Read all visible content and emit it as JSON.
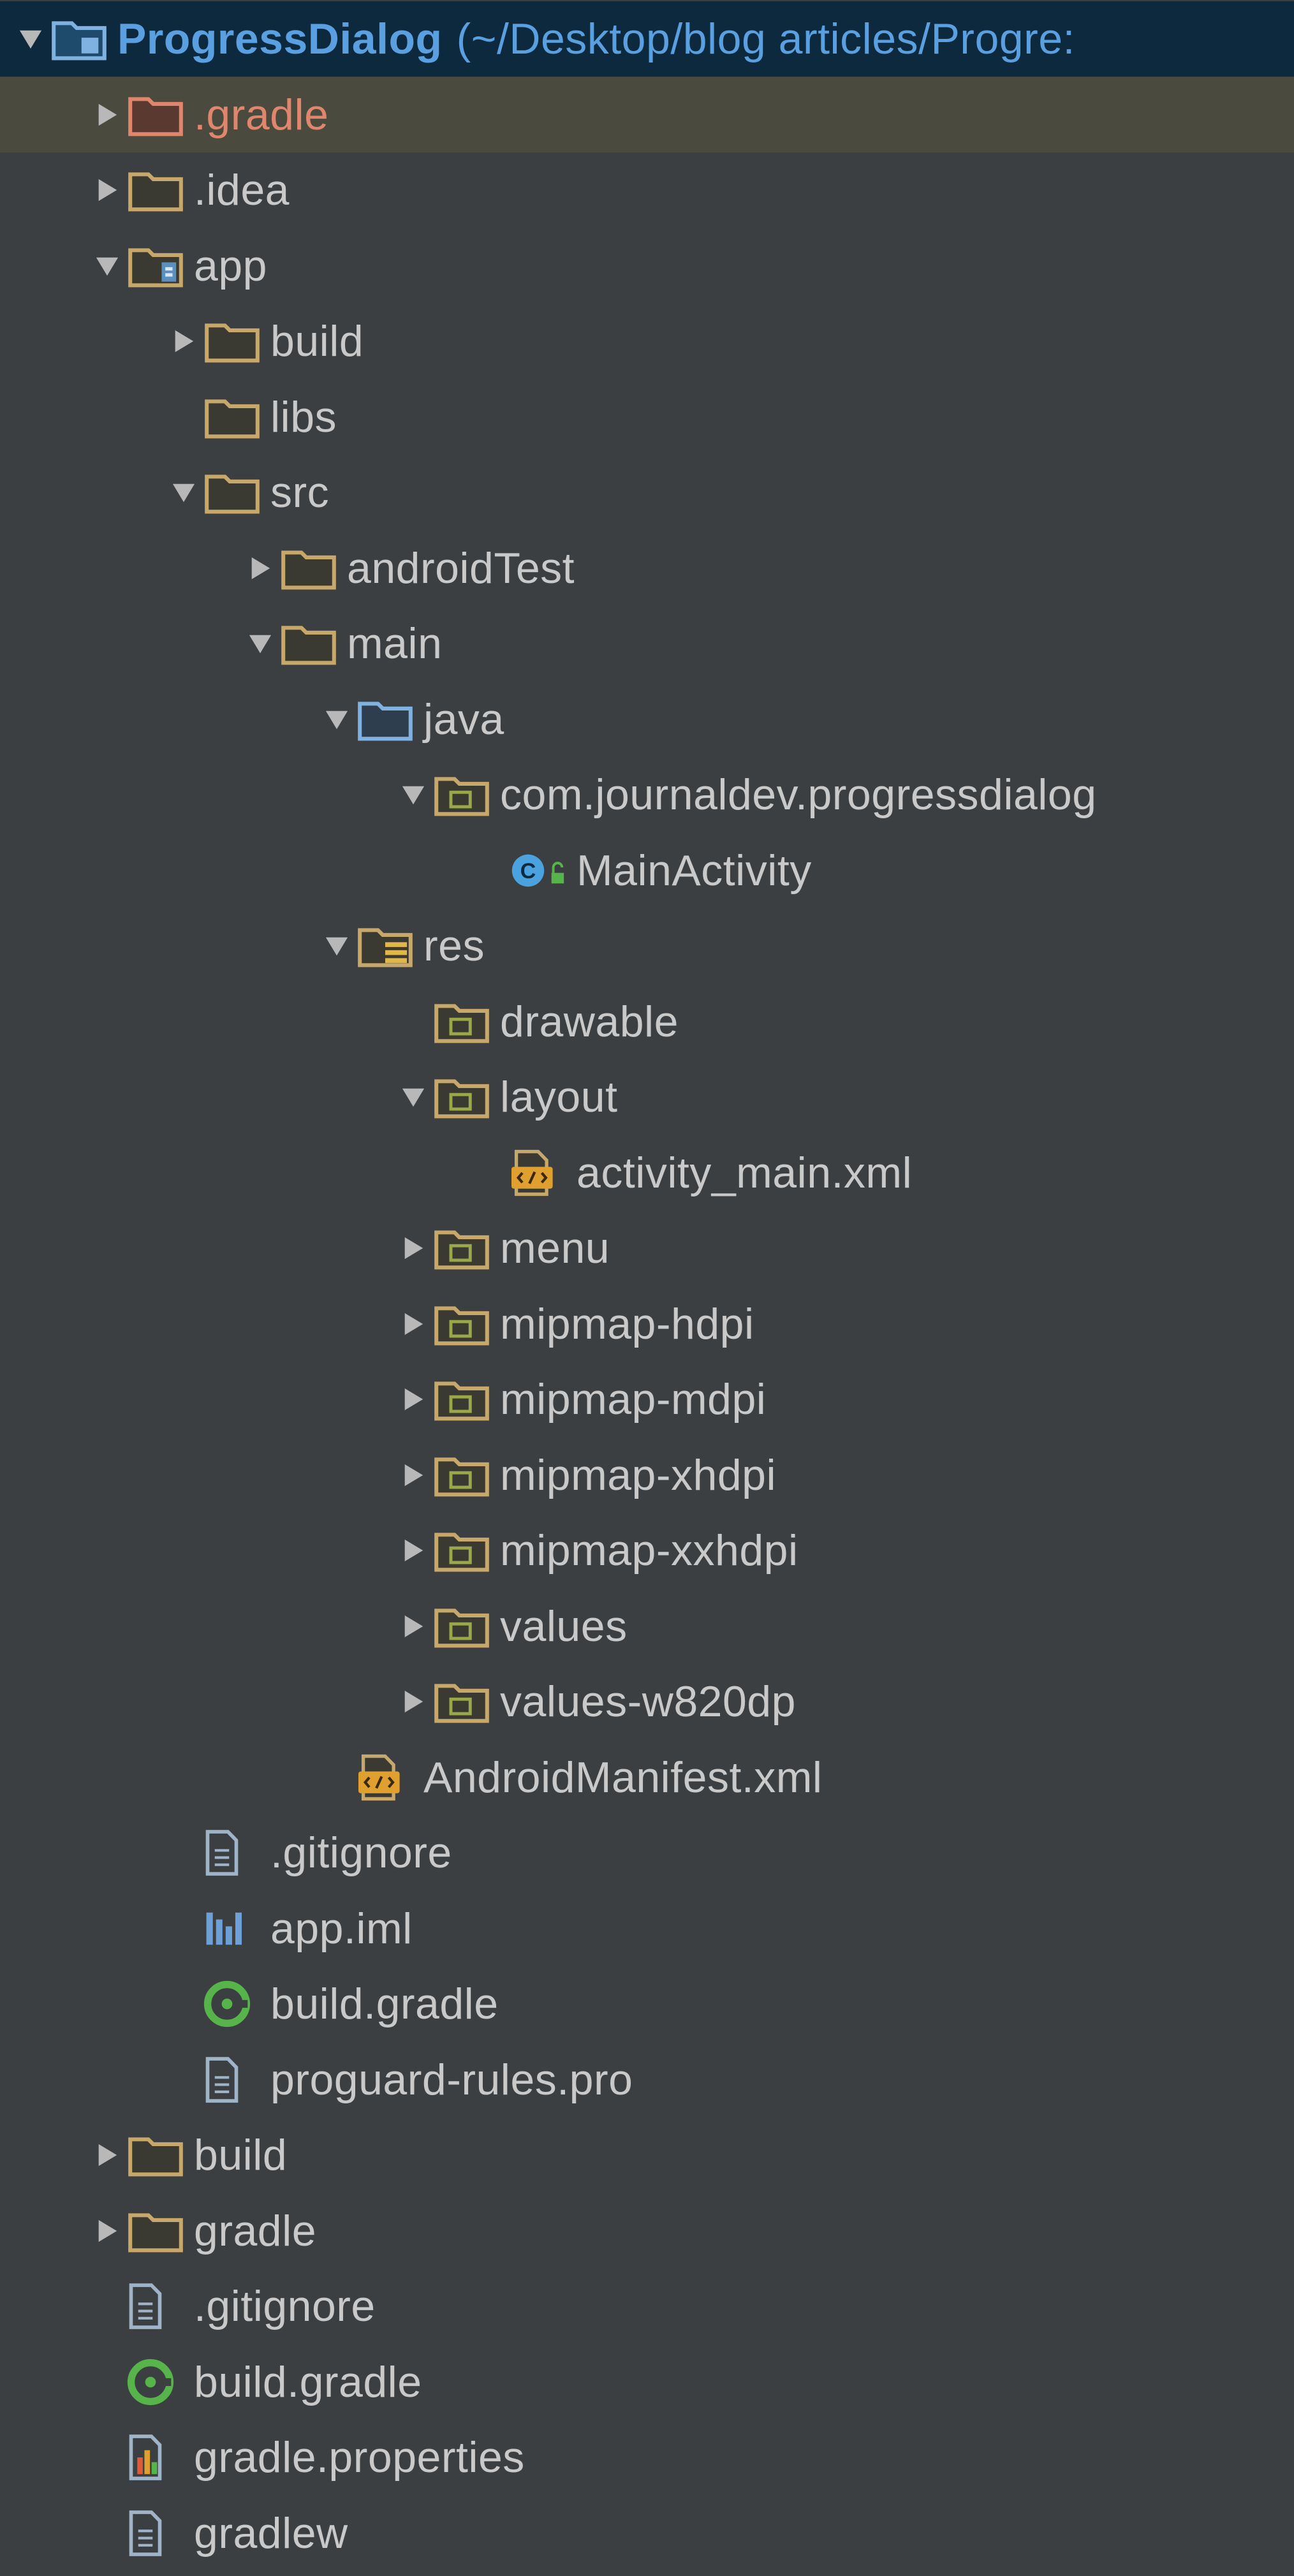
{
  "tree": {
    "project_name": "ProgressDialog",
    "project_path": "(~/Desktop/blog articles/Progre:",
    "items": [
      {
        "name": "project-root",
        "label": "ProgressDialog",
        "suffix": "(~/Desktop/blog articles/Progre:",
        "depth": 0,
        "arrow": "down",
        "icon": "project-folder-icon"
      },
      {
        "name": "folder-gradle-hidden",
        "label": ".gradle",
        "depth": 1,
        "arrow": "right",
        "icon": "excluded-folder-icon",
        "selected": true
      },
      {
        "name": "folder-idea",
        "label": ".idea",
        "depth": 1,
        "arrow": "right",
        "icon": "folder-icon"
      },
      {
        "name": "module-app",
        "label": "app",
        "depth": 1,
        "arrow": "down",
        "icon": "module-folder-icon"
      },
      {
        "name": "folder-app-build",
        "label": "build",
        "depth": 2,
        "arrow": "right",
        "icon": "folder-icon"
      },
      {
        "name": "folder-libs",
        "label": "libs",
        "depth": 2,
        "arrow": "none",
        "icon": "folder-icon"
      },
      {
        "name": "folder-src",
        "label": "src",
        "depth": 2,
        "arrow": "down",
        "icon": "folder-icon"
      },
      {
        "name": "folder-androidtest",
        "label": "androidTest",
        "depth": 3,
        "arrow": "right",
        "icon": "folder-icon"
      },
      {
        "name": "folder-main",
        "label": "main",
        "depth": 3,
        "arrow": "down",
        "icon": "folder-icon"
      },
      {
        "name": "folder-java",
        "label": "java",
        "depth": 4,
        "arrow": "down",
        "icon": "source-folder-icon"
      },
      {
        "name": "package-progressdialog",
        "label": "com.journaldev.progressdialog",
        "depth": 5,
        "arrow": "down",
        "icon": "package-icon"
      },
      {
        "name": "class-mainactivity",
        "label": "MainActivity",
        "depth": 6,
        "arrow": "none",
        "icon": "java-class-icon"
      },
      {
        "name": "folder-res",
        "label": "res",
        "depth": 4,
        "arrow": "down",
        "icon": "resource-folder-icon"
      },
      {
        "name": "folder-drawable",
        "label": "drawable",
        "depth": 5,
        "arrow": "none",
        "icon": "package-icon"
      },
      {
        "name": "folder-layout",
        "label": "layout",
        "depth": 5,
        "arrow": "down",
        "icon": "package-icon"
      },
      {
        "name": "file-activity-main-xml",
        "label": "activity_main.xml",
        "depth": 6,
        "arrow": "none",
        "icon": "xml-file-icon"
      },
      {
        "name": "folder-menu",
        "label": "menu",
        "depth": 5,
        "arrow": "right",
        "icon": "package-icon"
      },
      {
        "name": "folder-mipmap-hdpi",
        "label": "mipmap-hdpi",
        "depth": 5,
        "arrow": "right",
        "icon": "package-icon"
      },
      {
        "name": "folder-mipmap-mdpi",
        "label": "mipmap-mdpi",
        "depth": 5,
        "arrow": "right",
        "icon": "package-icon"
      },
      {
        "name": "folder-mipmap-xhdpi",
        "label": "mipmap-xhdpi",
        "depth": 5,
        "arrow": "right",
        "icon": "package-icon"
      },
      {
        "name": "folder-mipmap-xxhdpi",
        "label": "mipmap-xxhdpi",
        "depth": 5,
        "arrow": "right",
        "icon": "package-icon"
      },
      {
        "name": "folder-values",
        "label": "values",
        "depth": 5,
        "arrow": "right",
        "icon": "package-icon"
      },
      {
        "name": "folder-values-w820dp",
        "label": "values-w820dp",
        "depth": 5,
        "arrow": "right",
        "icon": "package-icon"
      },
      {
        "name": "file-androidmanifest-xml",
        "label": "AndroidManifest.xml",
        "depth": 4,
        "arrow": "none",
        "icon": "xml-file-icon"
      },
      {
        "name": "file-app-gitignore",
        "label": ".gitignore",
        "depth": 2,
        "arrow": "none",
        "icon": "text-file-icon"
      },
      {
        "name": "file-app-iml",
        "label": "app.iml",
        "depth": 2,
        "arrow": "none",
        "icon": "iml-file-icon"
      },
      {
        "name": "file-app-build-gradle",
        "label": "build.gradle",
        "depth": 2,
        "arrow": "none",
        "icon": "gradle-file-icon"
      },
      {
        "name": "file-proguard-rules",
        "label": "proguard-rules.pro",
        "depth": 2,
        "arrow": "none",
        "icon": "text-file-icon"
      },
      {
        "name": "folder-build",
        "label": "build",
        "depth": 1,
        "arrow": "right",
        "icon": "folder-icon"
      },
      {
        "name": "folder-gradle",
        "label": "gradle",
        "depth": 1,
        "arrow": "right",
        "icon": "folder-icon"
      },
      {
        "name": "file-root-gitignore",
        "label": ".gitignore",
        "depth": 1,
        "arrow": "none",
        "icon": "text-file-icon"
      },
      {
        "name": "file-root-build-gradle",
        "label": "build.gradle",
        "depth": 1,
        "arrow": "none",
        "icon": "gradle-file-icon"
      },
      {
        "name": "file-gradle-properties",
        "label": "gradle.properties",
        "depth": 1,
        "arrow": "none",
        "icon": "properties-file-icon"
      },
      {
        "name": "file-gradlew",
        "label": "gradlew",
        "depth": 1,
        "arrow": "none",
        "icon": "text-file-icon"
      }
    ]
  },
  "colors": {
    "background": "#3c3f41",
    "root_row": "#0d293e",
    "selected_row": "#4b4a3e",
    "text": "#c9c9c9",
    "project_text": "#5a9fe0",
    "excluded_text": "#e0866d",
    "folder": "#c8a86a",
    "source_folder": "#7fb2e0",
    "class_icon": "#4aa3df",
    "gradle_green": "#56b44a"
  }
}
